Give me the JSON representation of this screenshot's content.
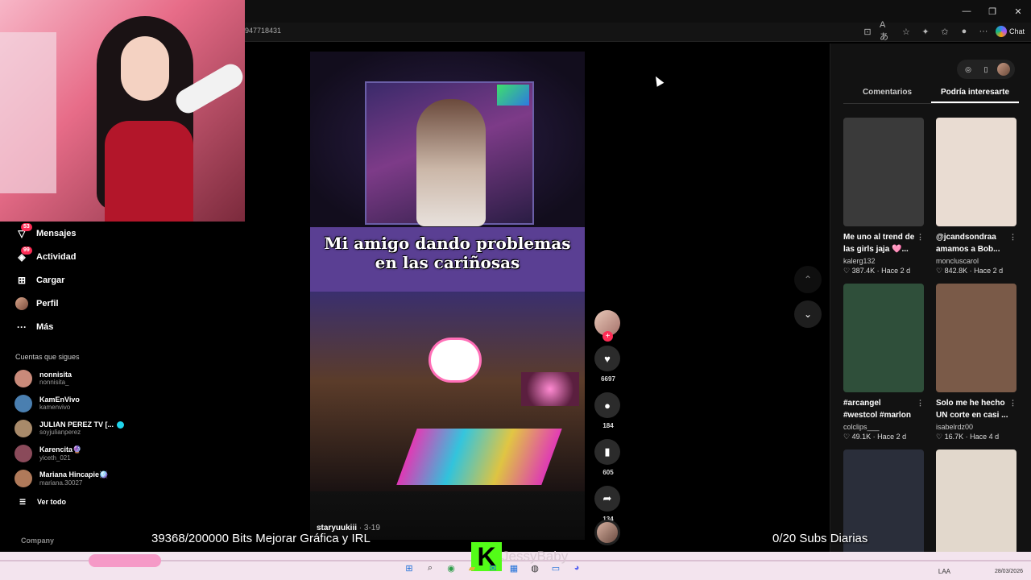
{
  "browser": {
    "url": "947718431",
    "chat_label": "Chat",
    "icons": [
      "app-icon",
      "translate-icon",
      "favorite-icon",
      "extensions-icon",
      "collections-icon",
      "profile-icon",
      "more-icon"
    ]
  },
  "window_controls": {
    "minimize": "—",
    "maximize": "❐",
    "close": "✕"
  },
  "sidebar": {
    "nav": [
      {
        "label": "Mensajes",
        "icon": "messages-icon",
        "glyph": "▽",
        "badge": "53"
      },
      {
        "label": "Actividad",
        "icon": "activity-icon",
        "glyph": "◈",
        "badge": "99"
      },
      {
        "label": "Cargar",
        "icon": "upload-icon",
        "glyph": "⊞",
        "badge": ""
      },
      {
        "label": "Perfil",
        "icon": "profile-avatar",
        "glyph": "",
        "badge": ""
      },
      {
        "label": "Más",
        "icon": "more-icon",
        "glyph": "···",
        "badge": ""
      }
    ],
    "following_title": "Cuentas que sigues",
    "following": [
      {
        "name": "nonnisita",
        "handle": "nonnisita_",
        "color": "#c98a7a",
        "verified": false
      },
      {
        "name": "KamEnVivo",
        "handle": "kamenvivo",
        "color": "#4a7fb0",
        "verified": false
      },
      {
        "name": "JULIAN PEREZ TV [...",
        "handle": "soyjulianperez",
        "color": "#a88a6a",
        "verified": true
      },
      {
        "name": "Karencita🔮",
        "handle": "yiceth_021",
        "color": "#8a4a5a",
        "verified": false
      },
      {
        "name": "Mariana Hincapie🪩",
        "handle": "mariana.30027",
        "color": "#b07a5a",
        "verified": false
      }
    ],
    "see_all": "Ver todo",
    "company": "Company"
  },
  "video": {
    "caption_line1": "Mi amigo dando problemas",
    "caption_line2": "en las cariñosas",
    "author": "staryuukiii",
    "date": " · 3-19"
  },
  "actions": {
    "likes": "6697",
    "comments": "184",
    "saves": "605",
    "shares": "134"
  },
  "right_panel": {
    "tabs": [
      "Comentarios",
      "Podría interesarte"
    ],
    "active_tab": 1,
    "cards": [
      {
        "title": "Me uno al trend de las girls jaja 🩷...",
        "user": "kalerg132",
        "likes": "387.4K",
        "time": "Hace 2 d",
        "color": "#3a3a3a"
      },
      {
        "title": "@jcandsondraa amamos a Bob...",
        "user": "moncluscarol",
        "likes": "842.8K",
        "time": "Hace 2 d",
        "color": "#e9dcd2"
      },
      {
        "title": "#arcangel #westcol #marlon",
        "user": "colclips___",
        "likes": "49.1K",
        "time": "Hace 2 d",
        "color": "#2f4f3a"
      },
      {
        "title": "Solo me he hecho UN corte en casi ...",
        "user": "isabelrdz00",
        "likes": "16.7K",
        "time": "Hace 4 d",
        "color": "#7a5a48"
      },
      {
        "title": "",
        "user": "",
        "likes": "",
        "time": "",
        "color": "#2a2e3a"
      },
      {
        "title": "",
        "user": "",
        "likes": "",
        "time": "",
        "color": "#e2d8cc"
      }
    ]
  },
  "overlay": {
    "bits": "39368/200000 Bits Mejorar Gráfica y IRL",
    "subs": "0/20 Subs Diarias",
    "kick_logo": "K",
    "kick_name": "JessyBaby"
  },
  "taskbar": {
    "lang": "LAA",
    "date": "28/03/2026"
  }
}
